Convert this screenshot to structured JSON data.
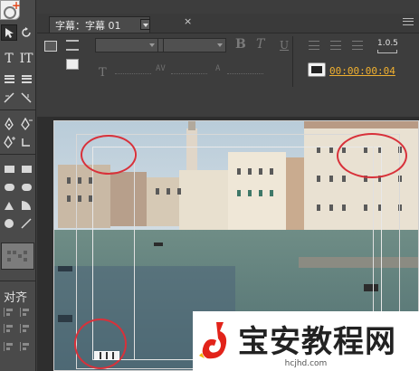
{
  "panel": {
    "tab_title": "字幕：字幕 01",
    "close_glyph": "×"
  },
  "toolbar": {
    "bold": "B",
    "italic": "T",
    "underline": "U",
    "tab_stops": "1.0.5",
    "timecode": "00:00:00:04",
    "kerning_label": "AV",
    "leading_label": "A"
  },
  "tools": {
    "text_h": "T",
    "text_v": "IT",
    "align_section_label": "对齐"
  },
  "watermark": {
    "brand": "宝安教程网",
    "url": "hcjhd.com"
  },
  "colors": {
    "timecode": "#f0b030",
    "highlight_circle": "#d8313a",
    "panel_bg": "#3d3d3d"
  },
  "icons": {
    "selection": "arrow-icon",
    "rotation": "rotate-icon",
    "title_properties": "title-properties-icon",
    "show_background_video": "monitor-icon"
  }
}
